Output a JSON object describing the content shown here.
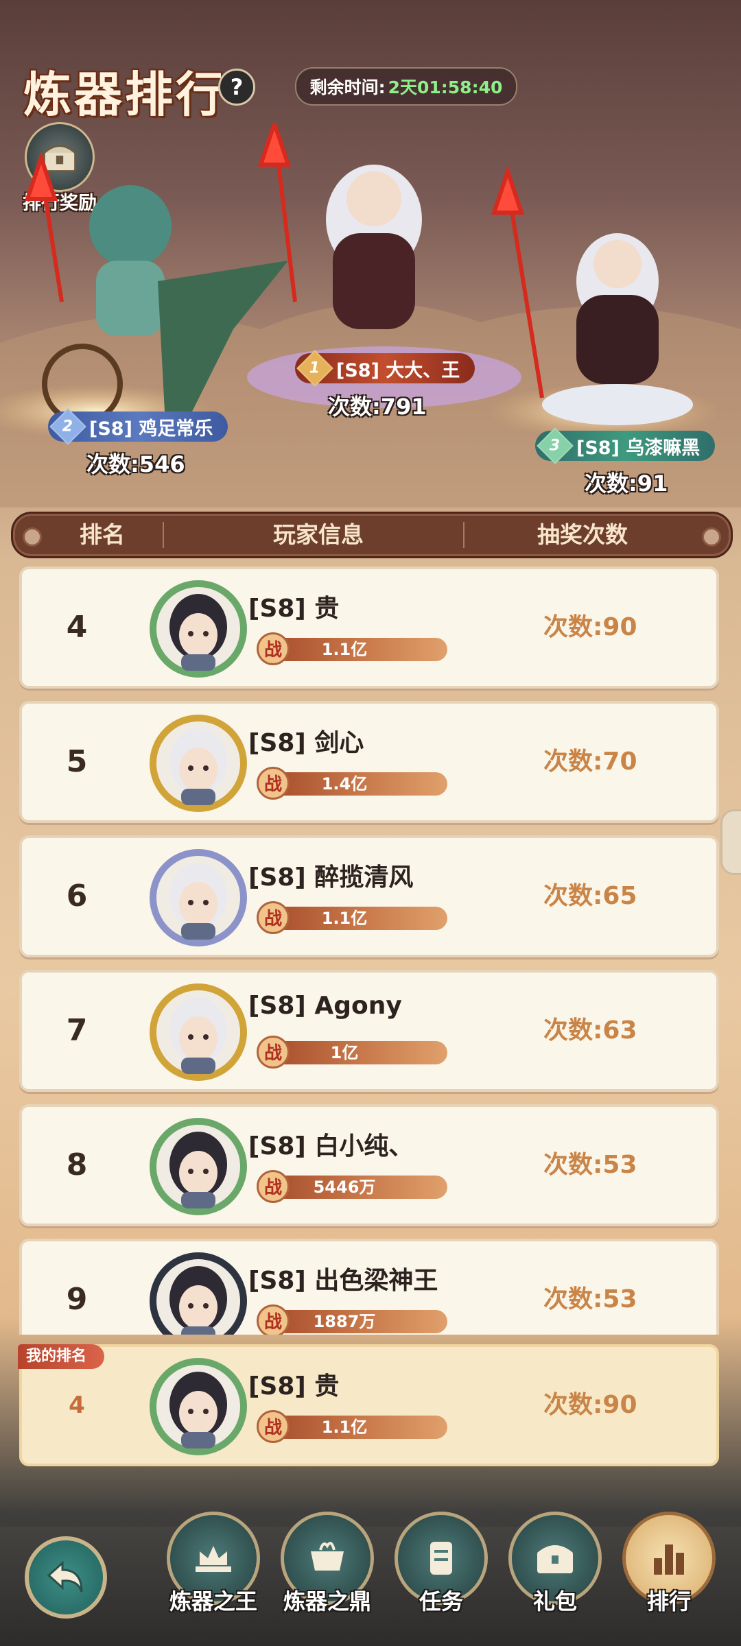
{
  "header": {
    "title": "炼器排行",
    "help_icon": "?",
    "timer_label": "剩余时间:",
    "timer_value": "2天01:58:40",
    "reward_label": "排行奖励"
  },
  "podium": [
    {
      "rank": "1",
      "name": "[S8] 大大、王",
      "count": "次数:791",
      "color": "#c24e2e"
    },
    {
      "rank": "2",
      "name": "[S8] 鸡足常乐",
      "count": "次数:546",
      "color": "#4f6fb4"
    },
    {
      "rank": "3",
      "name": "[S8] 乌漆嘛黑",
      "count": "次数:91",
      "color": "#3e9a7e"
    }
  ],
  "table": {
    "headers": [
      "排名",
      "玩家信息",
      "抽奖次数"
    ],
    "rows": [
      {
        "rank": "4",
        "name": "[S8] 贵",
        "power": "1.1亿",
        "times": "次数:90",
        "avatar": "dark-hair"
      },
      {
        "rank": "5",
        "name": "[S8] 剑心",
        "power": "1.4亿",
        "times": "次数:70",
        "avatar": "white-hair-gold"
      },
      {
        "rank": "6",
        "name": "[S8] 醉揽清风",
        "power": "1.1亿",
        "times": "次数:65",
        "avatar": "white-hair-blue"
      },
      {
        "rank": "7",
        "name": "[S8] Agony",
        "power": "1亿",
        "times": "次数:63",
        "avatar": "white-hair-gold"
      },
      {
        "rank": "8",
        "name": "[S8] 白小纯、",
        "power": "5446万",
        "times": "次数:53",
        "avatar": "dark-hair"
      },
      {
        "rank": "9",
        "name": "[S8] 出色梁神王",
        "power": "1887万",
        "times": "次数:53",
        "avatar": "dark-hair-plain"
      }
    ]
  },
  "my_rank": {
    "tag": "我的排名",
    "rank": "4",
    "name": "[S8] 贵",
    "power": "1.1亿",
    "times": "次数:90"
  },
  "power_icon": "战",
  "nav": {
    "back_icon": "back-arrow-icon",
    "tabs": [
      {
        "label": "炼器之王",
        "icon": "crown-icon",
        "active": false
      },
      {
        "label": "炼器之鼎",
        "icon": "cauldron-icon",
        "active": false
      },
      {
        "label": "任务",
        "icon": "scroll-icon",
        "active": false
      },
      {
        "label": "礼包",
        "icon": "gift-chest-icon",
        "active": false
      },
      {
        "label": "排行",
        "icon": "ranking-bars-icon",
        "active": true
      }
    ]
  }
}
